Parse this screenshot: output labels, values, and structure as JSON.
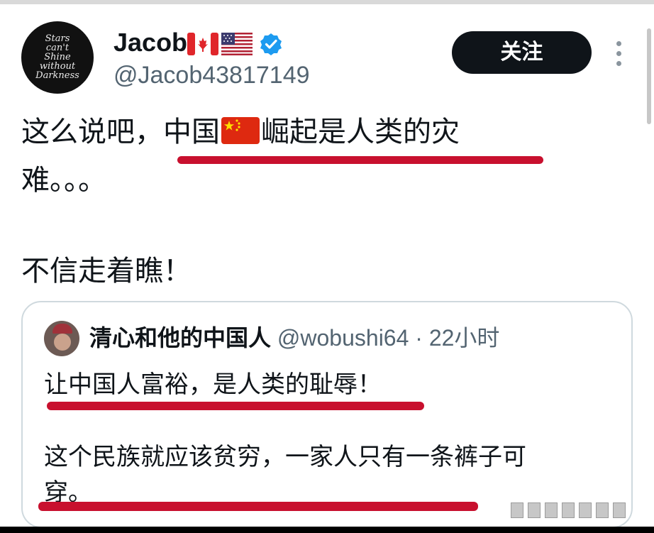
{
  "author": {
    "display_name": "Jacob",
    "handle": "@Jacob43817149",
    "avatar_text": "Stars\ncan't\nShine\nwithout\nDarkness",
    "flags": [
      "canada-flag",
      "us-flag"
    ],
    "verified": true
  },
  "follow_button": {
    "label": "关注"
  },
  "tweet": {
    "line1_before_flag": "这么说吧，中国",
    "line1_after_flag": "崛起是人类的灾",
    "line2": "难。。。",
    "line3": "不信走着瞧！"
  },
  "quoted_tweet": {
    "author_name": "清心和他的中国人",
    "handle_time": " @wobushi64 · 22小时",
    "line1": "让中国人富裕，是人类的耻辱！",
    "line2": "这个民族就应该贫穷，一家人只有一条裤子可",
    "line3": "穿。"
  },
  "colors": {
    "underline": "#c8102e",
    "button_bg": "#0f1419",
    "verified": "#1d9bf0",
    "muted_text": "#536471",
    "border": "#cfd9de"
  },
  "icons": {
    "verified": "verified-badge-icon",
    "more": "more-vertical-icon"
  }
}
